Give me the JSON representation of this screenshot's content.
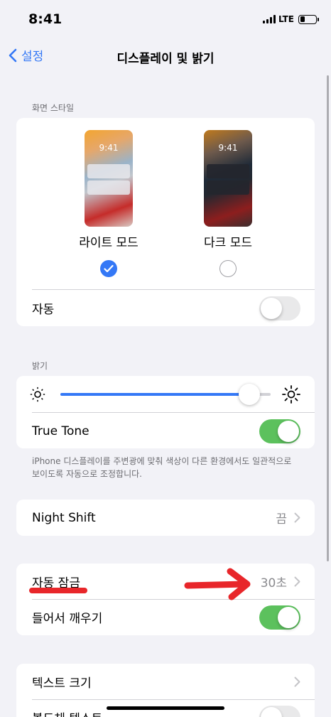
{
  "status_bar": {
    "time": "8:41",
    "network": "LTE"
  },
  "nav": {
    "back_label": "설정",
    "title": "디스플레이 및 밝기"
  },
  "appearance": {
    "header": "화면 스타일",
    "light": {
      "label": "라이트 모드",
      "preview_time": "9:41",
      "selected": true
    },
    "dark": {
      "label": "다크 모드",
      "preview_time": "9:41",
      "selected": false
    },
    "auto_label": "자동",
    "auto_on": false
  },
  "brightness": {
    "header": "밝기",
    "level": 0.9,
    "true_tone_label": "True Tone",
    "true_tone_on": true,
    "footer": "iPhone 디스플레이를 주변광에 맞춰 색상이 다른 환경에서도 일관적으로 보이도록 자동으로 조정합니다."
  },
  "night_shift": {
    "label": "Night Shift",
    "value": "끔"
  },
  "auto_lock": {
    "label": "자동 잠금",
    "value": "30초"
  },
  "raise_to_wake": {
    "label": "들어서 깨우기",
    "on": true
  },
  "text": {
    "text_size_label": "텍스트 크기",
    "bold_text_label": "볼드체 텍스트"
  },
  "colors": {
    "accent": "#3478f6",
    "toggle_on": "#5cc15d",
    "annotation": "#e8262a"
  }
}
